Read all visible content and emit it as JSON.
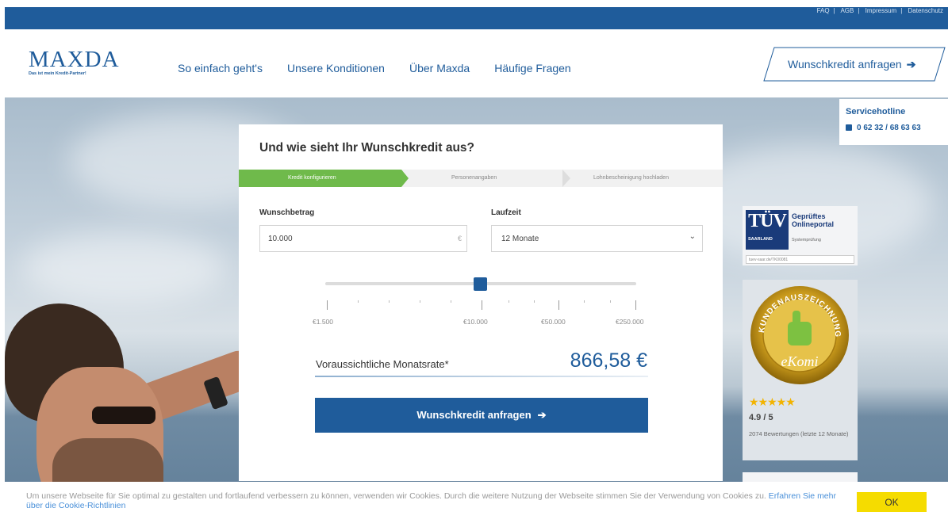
{
  "topbar": {
    "links": [
      "FAQ",
      "AGB",
      "Impressum",
      "Datenschutz"
    ]
  },
  "header": {
    "logo_text": "MAXDA",
    "logo_tagline": "Das ist mein Kredit-Partner!",
    "nav": [
      "So einfach geht's",
      "Unsere Konditionen",
      "Über Maxda",
      "Häufige Fragen"
    ],
    "cta_label": "Wunschkredit anfragen"
  },
  "hotline": {
    "title": "Servicehotline",
    "number": "0 62 32 / 68 63 63"
  },
  "form": {
    "title": "Und wie sieht Ihr Wunschkredit aus?",
    "steps": [
      "Kredit konfigurieren",
      "Personenangaben",
      "Lohnbescheinigung hochladen"
    ],
    "active_step": 0,
    "amount_label": "Wunschbetrag",
    "amount_value": "10.000",
    "currency_symbol": "€",
    "duration_label": "Laufzeit",
    "duration_value": "12 Monate",
    "slider_labels": [
      "€1.500",
      "€10.000",
      "€50.000",
      "€250.000"
    ],
    "rate_label": "Voraussichtliche Monatsrate*",
    "rate_value": "866,58 €",
    "submit_label": "Wunschkredit anfragen"
  },
  "tuv": {
    "logo_text": "TÜV",
    "logo_sub": "SAARLAND",
    "title_line1": "Geprüftes",
    "title_line2": "Onlineportal",
    "subtitle": "Systemprüfung",
    "url": "tuev-saar.de/TK00081"
  },
  "ekomi": {
    "seal_text": "KUNDENAUSZEICHNUNG",
    "brand": "eKomi",
    "stars": "★★★★★",
    "rating": "4.9 / 5",
    "reviews": "2074 Bewertungen (letzte 12 Monate)"
  },
  "cookie": {
    "text": "Um unsere Webseite für Sie optimal zu gestalten und fortlaufend verbessern zu können, verwenden wir Cookies. Durch die weitere Nutzung der Webseite stimmen Sie der Verwendung von Cookies zu.",
    "link": "Erfahren Sie mehr über die Cookie-Richtlinien",
    "ok_label": "OK"
  },
  "colors": {
    "brand_blue": "#1f5c9b",
    "step_green": "#6fba4b",
    "cookie_yellow": "#f5dc00"
  }
}
